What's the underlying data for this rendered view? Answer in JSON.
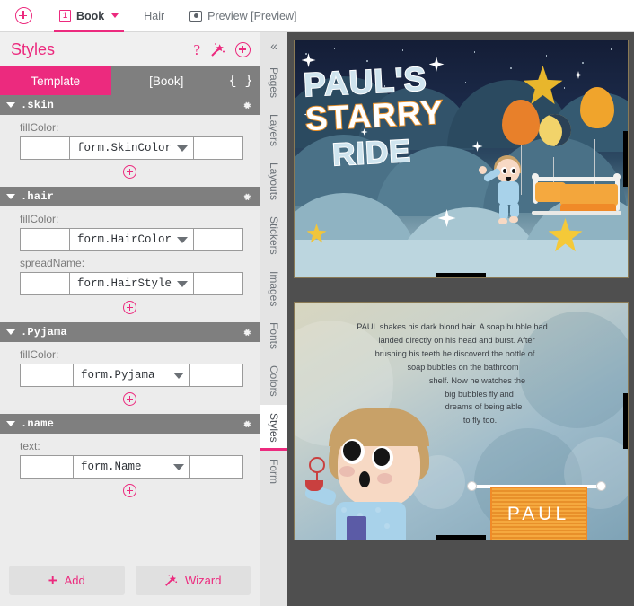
{
  "topbar": {
    "add_icon": "circle-plus-icon",
    "tabs": [
      {
        "badge": "1",
        "label": "Book",
        "has_caret": true,
        "active": true
      },
      {
        "label": "Hair",
        "active": false
      },
      {
        "icon": "eye-icon",
        "label": "Preview [Preview]",
        "active": false
      }
    ]
  },
  "panel": {
    "title": "Styles",
    "header_icons": [
      "help-icon",
      "wand-icon",
      "plus-circle-icon"
    ],
    "segments": [
      {
        "label": "Template",
        "active": true
      },
      {
        "label": "[Book]",
        "active": false
      }
    ],
    "braces_label": "{ }",
    "sections": [
      {
        "name": ".skin",
        "gear": "gear-icon",
        "properties": [
          {
            "label": "fillColor:",
            "prefix": "",
            "value": "form.SkinColor",
            "suffix": ""
          }
        ],
        "add_icon": "plus-circle-icon"
      },
      {
        "name": ".hair",
        "gear": "gear-icon",
        "properties": [
          {
            "label": "fillColor:",
            "prefix": "",
            "value": "form.HairColor",
            "suffix": ""
          },
          {
            "label": "spreadName:",
            "prefix": "",
            "value": "form.HairStyle",
            "suffix": ""
          }
        ],
        "add_icon": "plus-circle-icon"
      },
      {
        "name": ".Pyjama",
        "gear": "gear-icon",
        "properties": [
          {
            "label": "fillColor:",
            "prefix": "",
            "value": "form.Pyjama",
            "suffix": ""
          }
        ],
        "add_icon": "plus-circle-icon"
      },
      {
        "name": ".name",
        "gear": "gear-icon",
        "properties": [
          {
            "label": "text:",
            "prefix": "",
            "value": "form.Name",
            "suffix": ""
          }
        ],
        "add_icon": "plus-circle-icon"
      }
    ],
    "footer": {
      "add_label": "Add",
      "wizard_label": "Wizard"
    }
  },
  "rail": {
    "collapse_icon": "chevron-double-left-icon",
    "tabs": [
      {
        "label": "Pages",
        "active": false
      },
      {
        "label": "Layers",
        "active": false
      },
      {
        "label": "Layouts",
        "active": false
      },
      {
        "label": "Stickers",
        "active": false
      },
      {
        "label": "Images",
        "active": false
      },
      {
        "label": "Fonts",
        "active": false
      },
      {
        "label": "Colors",
        "active": false
      },
      {
        "label": "Styles",
        "active": true
      },
      {
        "label": "Form",
        "active": false
      }
    ]
  },
  "canvas": {
    "pages": [
      {
        "kind": "cover",
        "title_lines": [
          "PAUL'S",
          "STARRY",
          "RIDE"
        ]
      },
      {
        "kind": "story",
        "story_lines": [
          "PAUL shakes his dark blond hair.  A soap bubble had",
          "landed directly on his head and burst.  After",
          "brushing his teeth he discoverd the bottle of",
          "soap bubbles on the bathroom",
          "shelf.  Now he watches the",
          "big bubbles fly and",
          "dreams of being able",
          "to fly too."
        ],
        "sign_text": "PAUL"
      }
    ]
  },
  "colors": {
    "accent_pink": "#ec2a7e",
    "panel_bg": "#ececec",
    "section_header": "#7f7f7f",
    "canvas_bg": "#4f4f4f",
    "rail_bg": "#e4e4e4"
  }
}
